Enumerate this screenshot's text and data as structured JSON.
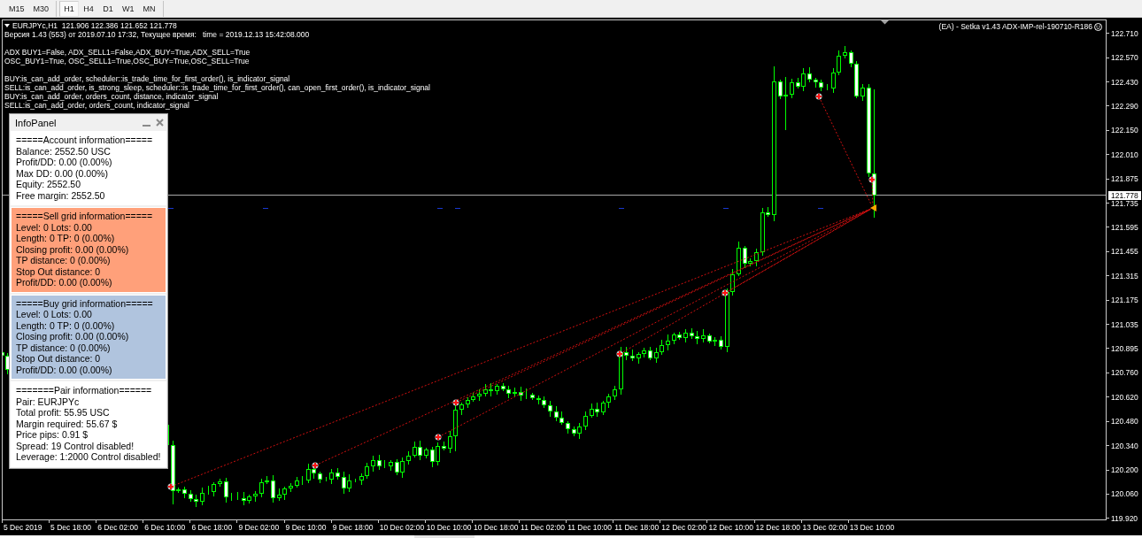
{
  "toolbar": {
    "timeframe_groups": [
      [
        {
          "label": "M15",
          "selected": false
        },
        {
          "label": "M30",
          "selected": false
        }
      ],
      [
        {
          "label": "H1",
          "selected": true
        },
        {
          "label": "H4",
          "selected": false
        },
        {
          "label": "D1",
          "selected": false
        },
        {
          "label": "W1",
          "selected": false
        },
        {
          "label": "MN",
          "selected": false
        }
      ]
    ]
  },
  "chart": {
    "symbol_line": "EURJPYc,H1  121.906 122.386 121.652 121.778",
    "info_blocks": [
      [
        "Версия 1.43 (553) от 2019.07.10 17:32, Текущее время:   time = 2019.12.13 15:42:08.000"
      ],
      [
        "ADX BUY1=False, ADX_SELL1=False,ADX_BUY=True,ADX_SELL=True",
        "OSC_BUY1=True, OSC_SELL1=True,OSC_BUY=True,OSC_SELL=True"
      ],
      [
        "BUY:is_can_add_order, scheduler::is_trade_time_for_first_order(), is_indicator_signal",
        "SELL:is_can_add_order, is_strong_sleep, scheduler::is_trade_time_for_first_order(), can_open_first_order(), is_indicator_signal",
        "BUY:is_can_add_order, orders_count, distance, indicator_signal",
        "SELL:is_can_add_order, orders_count, indicator_signal"
      ]
    ],
    "expert_label": "(EA) - Setka v1.43 ADX-IMP-rel-190710-R186",
    "current_price": "121.778",
    "price_axis": [
      "122.710",
      "122.570",
      "122.430",
      "122.290",
      "122.150",
      "122.010",
      "121.875",
      "121.735",
      "121.595",
      "121.455",
      "121.315",
      "121.175",
      "121.035",
      "120.895",
      "120.760",
      "120.620",
      "120.480",
      "120.340",
      "120.200",
      "120.060",
      "119.920"
    ],
    "time_axis": [
      "5 Dec 2019",
      "5 Dec 18:00",
      "6 Dec 02:00",
      "6 Dec 10:00",
      "6 Dec 18:00",
      "9 Dec 02:00",
      "9 Dec 10:00",
      "9 Dec 18:00",
      "10 Dec 02:00",
      "10 Dec 10:00",
      "10 Dec 18:00",
      "11 Dec 02:00",
      "11 Dec 10:00",
      "11 Dec 18:00",
      "12 Dec 02:00",
      "12 Dec 10:00",
      "12 Dec 18:00",
      "13 Dec 02:00",
      "13 Dec 10:00"
    ]
  },
  "info_panel": {
    "title": "InfoPanel",
    "sections": [
      {
        "heading": "=====Account information=====",
        "color": "#ffffff",
        "lines": [
          "Balance: 2552.50 USC",
          "Profit/DD: 0.00 (0.00%)",
          "Max DD: 0.00 (0.00%)",
          "Equity: 2552.50",
          "Free margin: 2552.50"
        ]
      },
      {
        "heading": "=====Sell grid information=====",
        "color": "#ffa07a",
        "lines": [
          "Level: 0 Lots: 0.00",
          "Length: 0 TP: 0 (0.00%)",
          "Closing profit: 0.00 (0.00%)",
          "TP distance: 0 (0.00%)",
          "Stop Out distance: 0",
          "Profit/DD: 0.00 (0.00%)"
        ]
      },
      {
        "heading": "=====Buy grid information=====",
        "color": "#b0c4de",
        "lines": [
          "Level: 0 Lots: 0.00",
          "Length: 0 TP: 0 (0.00%)",
          "Closing profit: 0.00 (0.00%)",
          "TP distance: 0 (0.00%)",
          "Stop Out distance: 0",
          "Profit/DD: 0.00 (0.00%)"
        ]
      },
      {
        "heading": "=======Pair information======",
        "color": "#ffffff",
        "lines": [
          "Pair: EURJPYc",
          "Total profit: 55.95 USC",
          "Margin required: 55.67 $",
          "Price pips: 0.91 $",
          "Spread: 19 Control disabled!",
          "Leverage: 1:2000 Control disabled!"
        ]
      }
    ]
  }
}
